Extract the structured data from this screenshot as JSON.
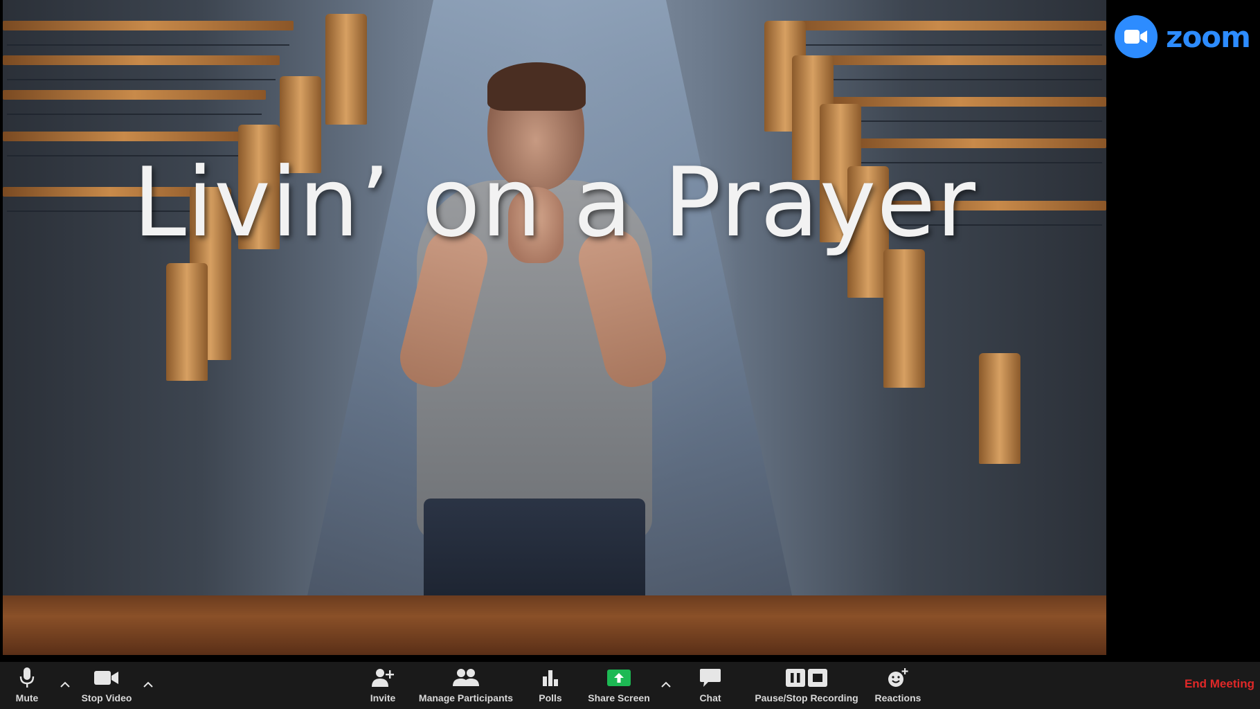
{
  "slide": {
    "title": "Livin’ on a Prayer"
  },
  "branding": {
    "logo_text": "zoom",
    "logo_color": "#2D8CFF"
  },
  "toolbar": {
    "mute_label": "Mute",
    "stop_video_label": "Stop Video",
    "invite_label": "Invite",
    "manage_participants_label": "Manage Participants",
    "polls_label": "Polls",
    "share_screen_label": "Share Screen",
    "chat_label": "Chat",
    "recording_label": "Pause/Stop Recording",
    "reactions_label": "Reactions",
    "end_meeting_label": "End Meeting",
    "share_color": "#1DB954",
    "end_color": "#E02828"
  },
  "icons": {
    "mute": "microphone-icon",
    "video": "camera-icon",
    "invite": "add-person-icon",
    "participants": "people-icon",
    "polls": "bar-chart-icon",
    "share": "share-arrow-icon",
    "chat": "speech-bubble-icon",
    "recording": "pause-stop-icon",
    "reactions": "smiley-plus-icon"
  }
}
